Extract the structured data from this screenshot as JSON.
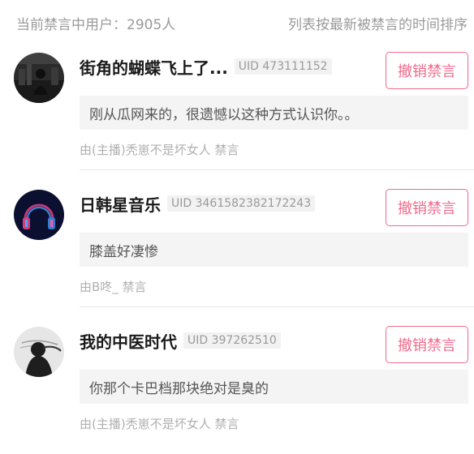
{
  "header": {
    "count_text": "当前禁言中用户：2905人",
    "order_text": "列表按最新被禁言的时间排序"
  },
  "items": [
    {
      "name": "街角的蝴蝶飞上了...",
      "uid": "UID 473111152",
      "revoke_label": "撤销禁言",
      "message": "刚从瓜网来的，很遗憾以这种方式认识你。。",
      "meta": "由(主播)秃崽不是坏女人 禁言"
    },
    {
      "name": "日韩星音乐",
      "uid": "UID 3461582382172243",
      "revoke_label": "撤销禁言",
      "message": "膝盖好凄惨",
      "meta": "由B咚_ 禁言"
    },
    {
      "name": "我的中医时代",
      "uid": "UID 397262510",
      "revoke_label": "撤销禁言",
      "message": "你那个卡巴档那块绝对是臭的",
      "meta": "由(主播)秃崽不是坏女人 禁言"
    }
  ],
  "colors": {
    "accent": "#f06a8b",
    "muted_text": "#9a9a9a",
    "message_bg": "#f4f4f4"
  }
}
